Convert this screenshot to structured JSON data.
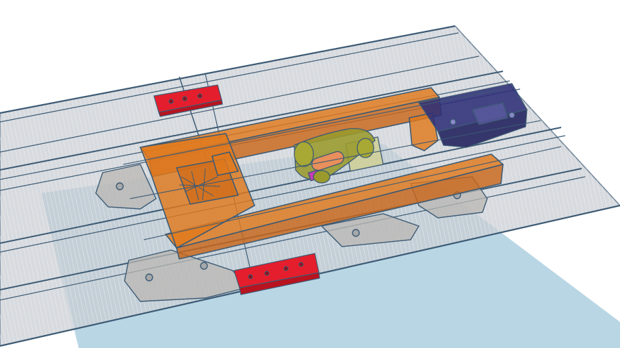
{
  "scene": {
    "background": "#ffffff",
    "workplane_color": "#7fb5cf",
    "workplane_grid_color": "#b9d6e4",
    "rail_sheet_color": "#c9cdd2",
    "outline_color": "#3c5a74",
    "frame_color": "#e0791c",
    "bogie_color": "#b9b7b3",
    "pivot_color": "#9a9a2c",
    "pivot_plate_color": "#cfcf9a",
    "axle_color": "#e88f5c",
    "magenta_color": "#c43fb5",
    "bracket_color": "#2f2f78",
    "block_color": "#e41e2c",
    "selected_objects": [
      "baseboard-sheet",
      "rail-track",
      "chassis-frame",
      "bogie-frame-left",
      "bogie-frame-right",
      "pivot-link",
      "motor-bracket",
      "red-block-top",
      "red-block-bottom"
    ]
  }
}
